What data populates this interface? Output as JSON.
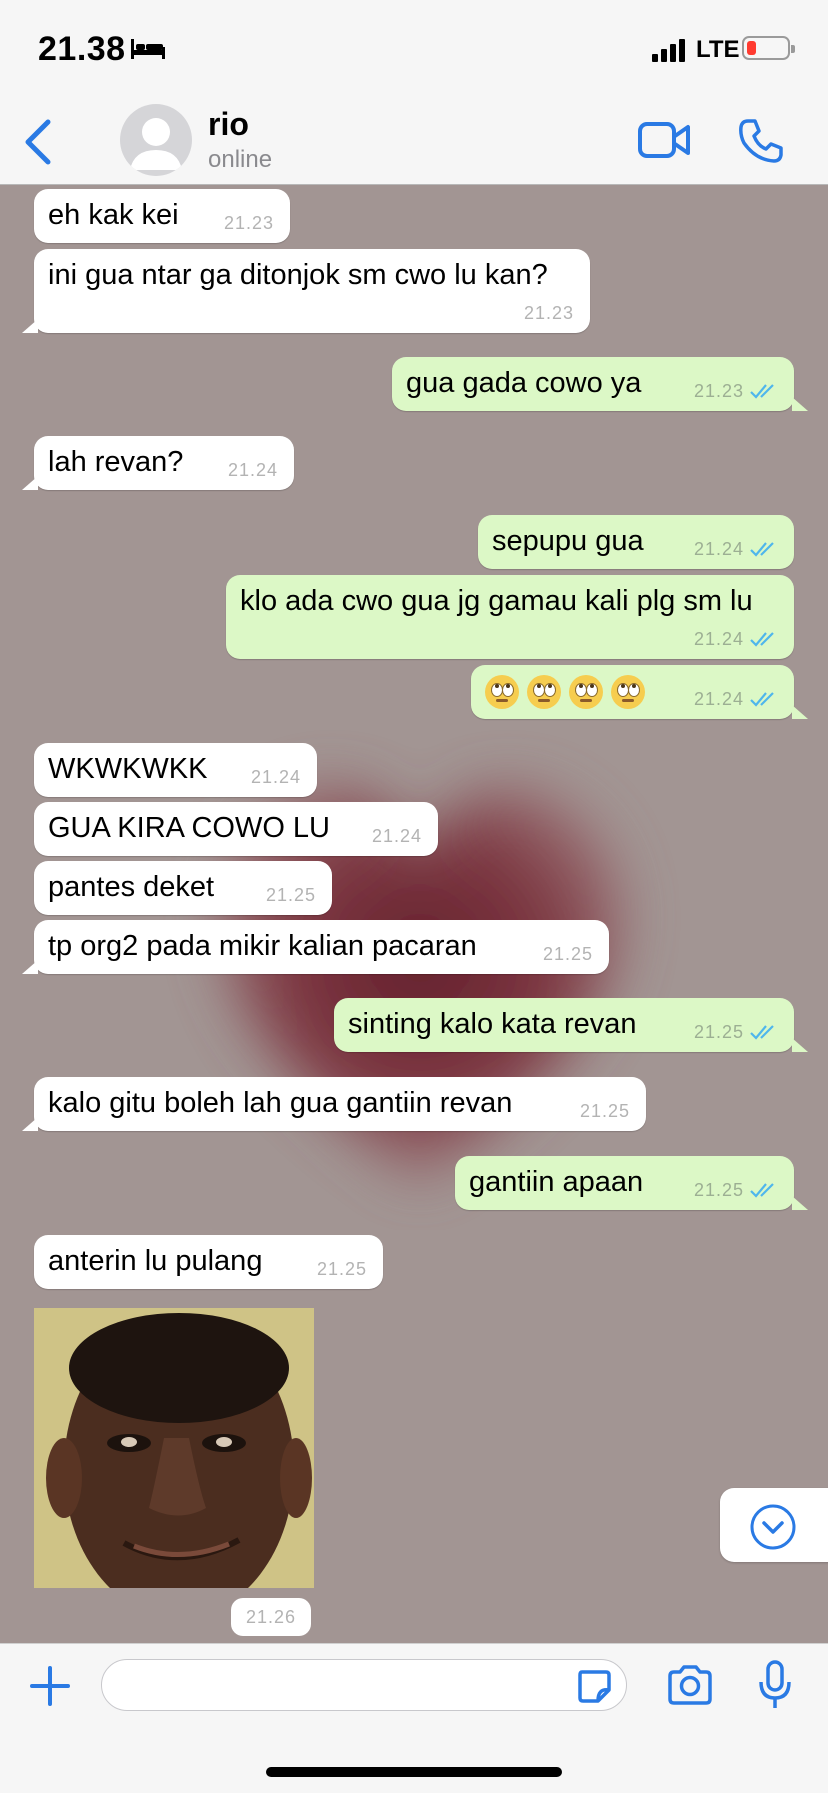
{
  "status_bar": {
    "time": "21.38",
    "network": "LTE",
    "battery_color": "#ff3b30"
  },
  "header": {
    "contact_name": "rio",
    "contact_status": "online",
    "accent": "#2a7ae4"
  },
  "messages": [
    {
      "dir": "in",
      "text": "eh kak kei",
      "time": "21.23"
    },
    {
      "dir": "in",
      "text": "ini gua ntar ga ditonjok sm cwo lu kan?",
      "time": "21.23"
    },
    {
      "dir": "out",
      "text": "gua gada cowo ya",
      "time": "21.23"
    },
    {
      "dir": "in",
      "text": "lah revan?",
      "time": "21.24"
    },
    {
      "dir": "out",
      "text": "sepupu gua",
      "time": "21.24"
    },
    {
      "dir": "out",
      "text": "klo ada cwo gua jg gamau kali plg sm lu",
      "time": "21.24"
    },
    {
      "dir": "out",
      "text": "",
      "emoji": "face-with-rolling-eyes",
      "emoji_count": 4,
      "time": "21.24"
    },
    {
      "dir": "in",
      "text": "WKWKWKK",
      "time": "21.24"
    },
    {
      "dir": "in",
      "text": "GUA KIRA COWO LU",
      "time": "21.24"
    },
    {
      "dir": "in",
      "text": "pantes deket",
      "time": "21.25"
    },
    {
      "dir": "in",
      "text": "tp org2 pada mikir kalian pacaran",
      "time": "21.25"
    },
    {
      "dir": "out",
      "text": "sinting kalo kata revan",
      "time": "21.25"
    },
    {
      "dir": "in",
      "text": "kalo gitu boleh lah gua gantiin revan",
      "time": "21.25"
    },
    {
      "dir": "out",
      "text": "gantiin apaan",
      "time": "21.25"
    },
    {
      "dir": "in",
      "text": "anterin lu pulang",
      "time": "21.25"
    },
    {
      "dir": "in",
      "type": "image",
      "image": "smiling-man-photo",
      "time": "21.26"
    }
  ],
  "composer": {
    "value": "",
    "icons": [
      "plus-icon",
      "sticker-icon",
      "camera-icon",
      "microphone-icon"
    ]
  },
  "colors": {
    "incoming": "#ffffff",
    "outgoing": "#dcf8c6",
    "wallpaper": "#a29593",
    "read_ticks": "#4fb6ec"
  }
}
